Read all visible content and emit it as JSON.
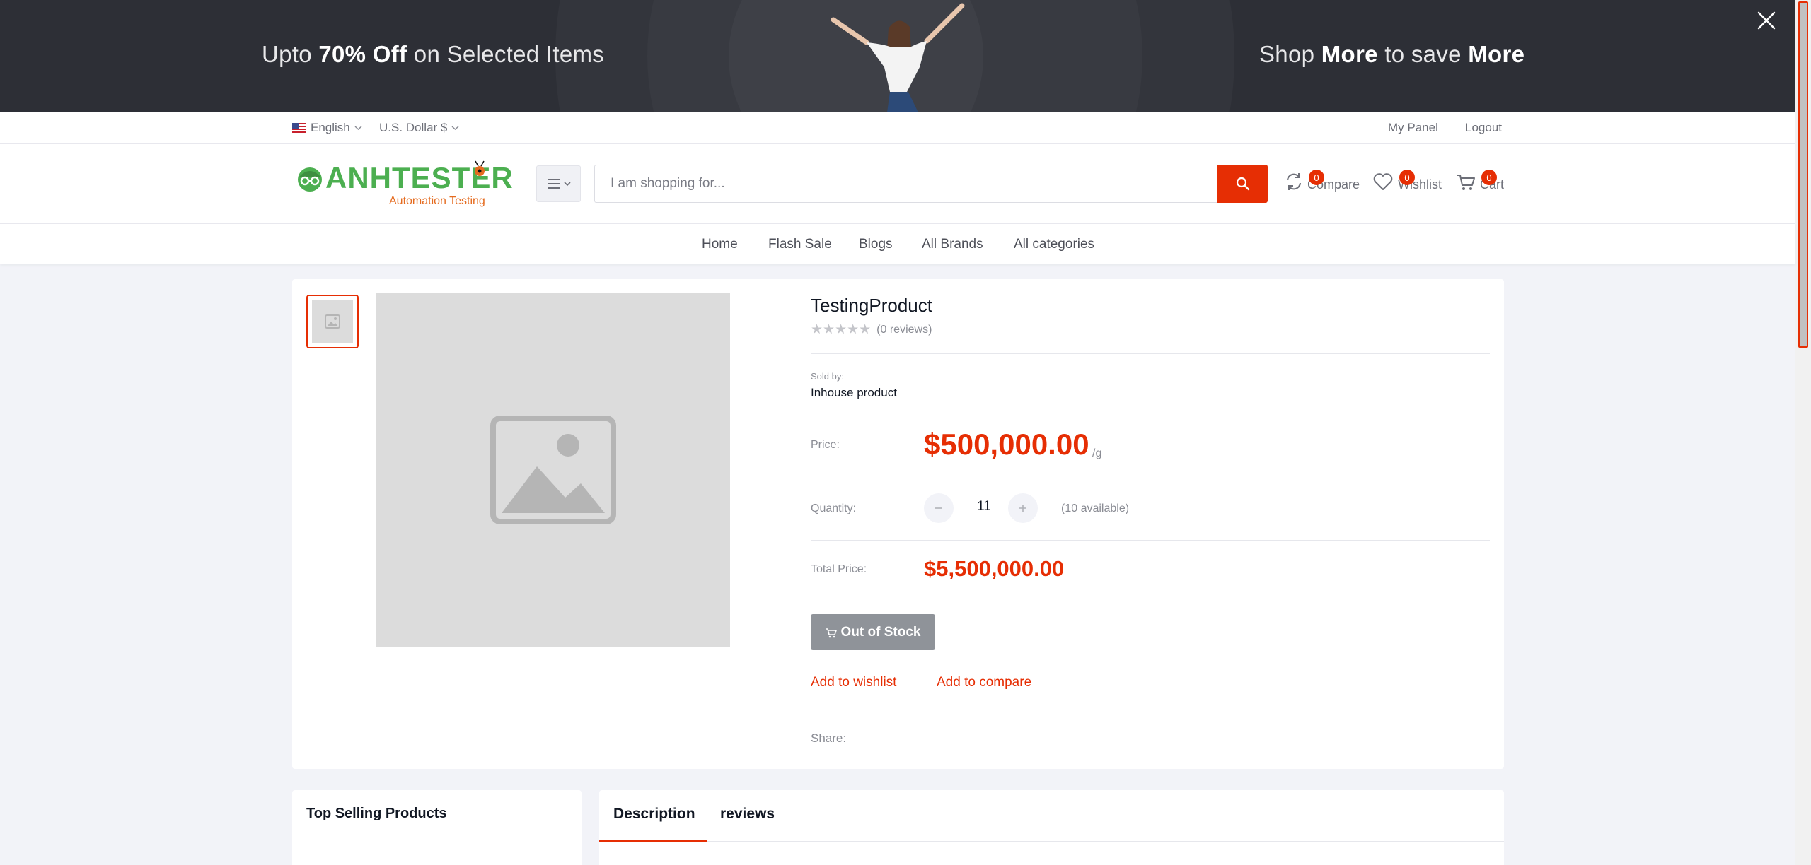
{
  "banner": {
    "left_pre": "Upto ",
    "left_bold": "70% Off",
    "left_post": " on Selected Items",
    "right_pre": "Shop ",
    "right_bold1": "More",
    "right_mid": " to save ",
    "right_bold2": "More"
  },
  "topbar": {
    "language": "English",
    "currency": "U.S. Dollar $",
    "my_panel": "My Panel",
    "logout": "Logout"
  },
  "header": {
    "logo_text": "ANHTESTER",
    "logo_sub": "Automation Testing",
    "search_placeholder": "I am shopping for...",
    "compare_label": "Compare",
    "compare_count": "0",
    "wishlist_label": "Wishlist",
    "wishlist_count": "0",
    "cart_label": "Cart",
    "cart_count": "0"
  },
  "nav": {
    "items": [
      "Home",
      "Flash Sale",
      "Blogs",
      "All Brands",
      "All categories"
    ]
  },
  "product": {
    "title": "TestingProduct",
    "rating_stars": 0,
    "reviews_text": "(0 reviews)",
    "sold_by_label": "Sold by:",
    "sold_by_value": "Inhouse product",
    "price_label": "Price:",
    "price": "$500,000.00",
    "unit": "/g",
    "quantity_label": "Quantity:",
    "quantity": "11",
    "available": "(10 available)",
    "total_label": "Total Price:",
    "total": "$5,500,000.00",
    "out_of_stock": "Out of Stock",
    "add_to_wishlist": "Add to wishlist",
    "add_to_compare": "Add to compare",
    "share_label": "Share:"
  },
  "bottom": {
    "top_selling": "Top Selling Products",
    "tab_description": "Description",
    "tab_reviews": "reviews"
  },
  "colors": {
    "accent": "#e62e04",
    "banner_bg": "#2d2f36",
    "logo_green": "#4caf50",
    "logo_orange": "#e56b1f"
  }
}
